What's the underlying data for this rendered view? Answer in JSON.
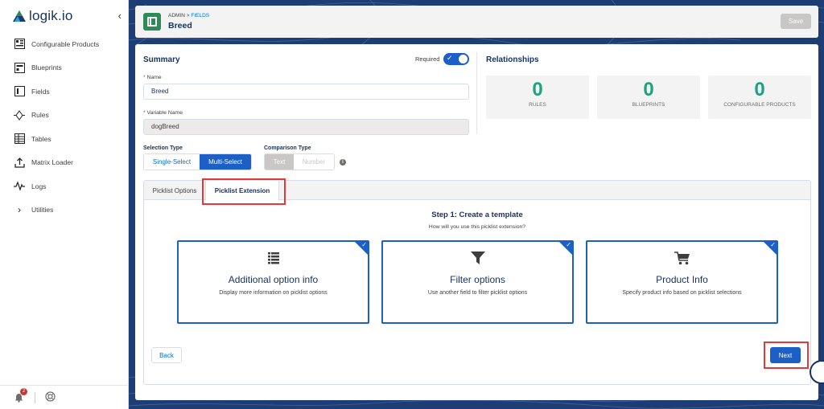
{
  "app": {
    "logo_text": "logik.io",
    "collapse_icon": "chevron-left-icon"
  },
  "sidebar": {
    "items": [
      {
        "label": "Configurable Products",
        "icon": "configurable-products-icon"
      },
      {
        "label": "Blueprints",
        "icon": "blueprint-icon"
      },
      {
        "label": "Fields",
        "icon": "field-icon"
      },
      {
        "label": "Rules",
        "icon": "rules-icon"
      },
      {
        "label": "Tables",
        "icon": "table-icon"
      },
      {
        "label": "Matrix Loader",
        "icon": "upload-icon"
      },
      {
        "label": "Logs",
        "icon": "activity-icon"
      },
      {
        "label": "Utilities",
        "icon": "chevron-right-icon"
      }
    ],
    "notifications_count": "2"
  },
  "header": {
    "breadcrumb_root": "ADMIN",
    "breadcrumb_sep": ">",
    "breadcrumb_current": "FIELDS",
    "title": "Breed",
    "save_label": "Save"
  },
  "summary": {
    "title": "Summary",
    "required_label": "Required",
    "required_on": true,
    "name_label": "Name",
    "name_value": "Breed",
    "variable_label": "Variable Name",
    "variable_value": "dogBreed",
    "selection_type_label": "Selection Type",
    "selection_options": [
      "Single-Select",
      "Multi-Select"
    ],
    "selection_selected": "Multi-Select",
    "comparison_type_label": "Comparison Type",
    "comparison_options": [
      "Text",
      "Number"
    ],
    "comparison_selected": "Text"
  },
  "relationships": {
    "title": "Relationships",
    "boxes": [
      {
        "count": "0",
        "label": "RULES"
      },
      {
        "count": "0",
        "label": "BLUEPRINTS"
      },
      {
        "count": "0",
        "label": "CONFIGURABLE PRODUCTS"
      }
    ]
  },
  "tabs": {
    "items": [
      "Picklist Options",
      "Picklist Extension"
    ],
    "active": "Picklist Extension"
  },
  "wizard": {
    "step_title": "Step 1: Create a template",
    "step_subtitle": "How will you use this picklist extension?",
    "options": [
      {
        "title": "Additional option info",
        "desc": "Display more information on picklist options",
        "icon": "list-icon",
        "selected": true
      },
      {
        "title": "Filter options",
        "desc": "Use another field to filter picklist options",
        "icon": "filter-icon",
        "selected": true
      },
      {
        "title": "Product Info",
        "desc": "Specify product info based on picklist selections",
        "icon": "cart-icon",
        "selected": true
      }
    ],
    "back_label": "Back",
    "next_label": "Next"
  },
  "colors": {
    "brand": "#1b5fc7",
    "accent_green": "#1ca37e",
    "highlight_red": "#e03a3a"
  }
}
